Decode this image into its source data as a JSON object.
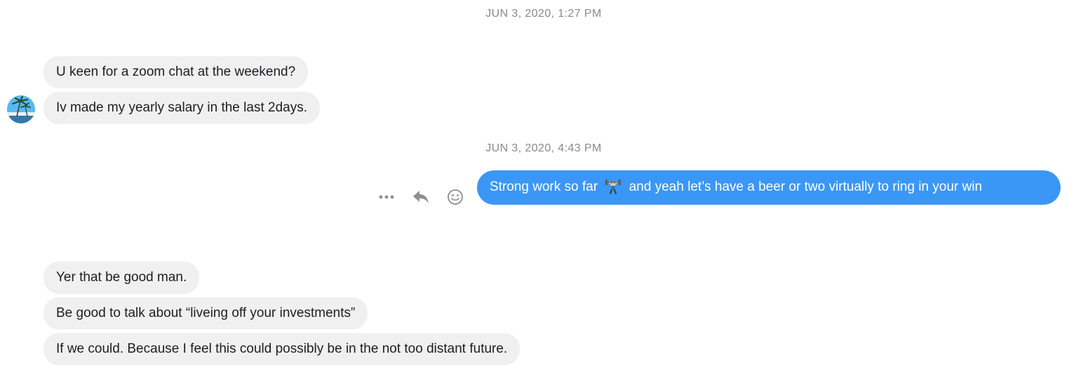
{
  "thread": {
    "groups": [
      {
        "timestamp": "JUN 3, 2020, 1:27 PM",
        "messages": [
          "U keen for a zoom chat at the weekend?",
          "Iv made my yearly salary in the last 2days."
        ]
      },
      {
        "timestamp": "JUN 3, 2020, 4:43 PM",
        "outgoing": {
          "text_before_emoji": "Strong work so far",
          "emoji": "weightlifter-emoji",
          "text_after_emoji": "and yeah let’s have a beer or two virtually to ring in your win"
        }
      },
      {
        "messages": [
          "Yer that be good man.",
          "Be good to talk about “liveing off your investments”",
          "If we could. Because I feel this could possibly be in the not too distant future."
        ]
      }
    ]
  },
  "actions": [
    "more-icon",
    "reply-icon",
    "react-icon"
  ],
  "colors": {
    "incoming_bubble": "#f0f0f0",
    "outgoing_bubble": "#3a97f6",
    "timestamp": "#8a8a8e",
    "icon": "#8e8e93"
  }
}
